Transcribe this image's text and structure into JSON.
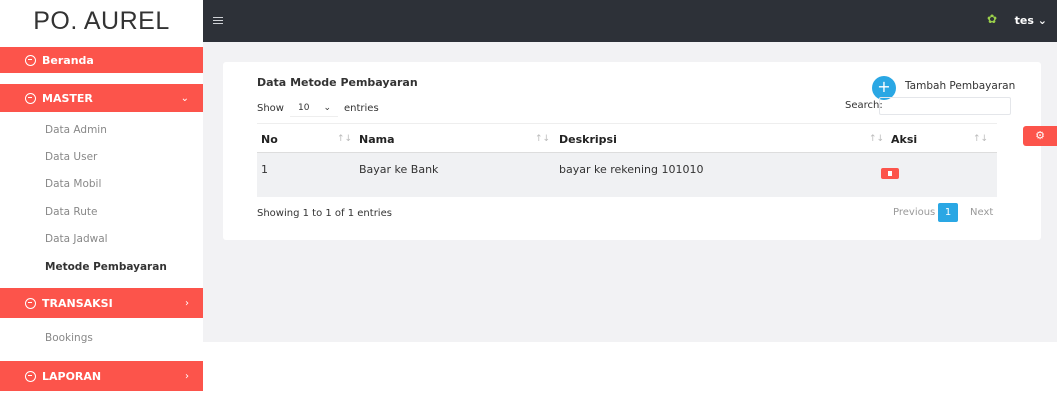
{
  "brand": "PO. AUREL",
  "sidebar": {
    "beranda": "Beranda",
    "master": "MASTER",
    "master_items": [
      "Data Admin",
      "Data User",
      "Data Mobil",
      "Data Rute",
      "Data Jadwal",
      "Metode Pembayaran"
    ],
    "transaksi": "TRANSAKSI",
    "transaksi_items": [
      "Bookings"
    ],
    "laporan": "LAPORAN"
  },
  "topbar": {
    "username": "tes"
  },
  "card": {
    "title": "Data Metode Pembayaran",
    "add_label": "Tambah Pembayaran",
    "show_label": "Show",
    "entries_value": "10",
    "entries_label": "entries",
    "search_label": "Search:",
    "columns": [
      "No",
      "Nama",
      "Deskripsi",
      "Aksi"
    ],
    "rows": [
      {
        "no": "1",
        "nama": "Bayar ke Bank",
        "deskripsi": "bayar ke rekening 101010"
      }
    ],
    "showing": "Showing 1 to 1 of 1 entries",
    "previous": "Previous",
    "page": "1",
    "next": "Next"
  },
  "colors": {
    "accent": "#fc544b",
    "primary": "#2aa7e4",
    "topbar": "#2d3138"
  }
}
